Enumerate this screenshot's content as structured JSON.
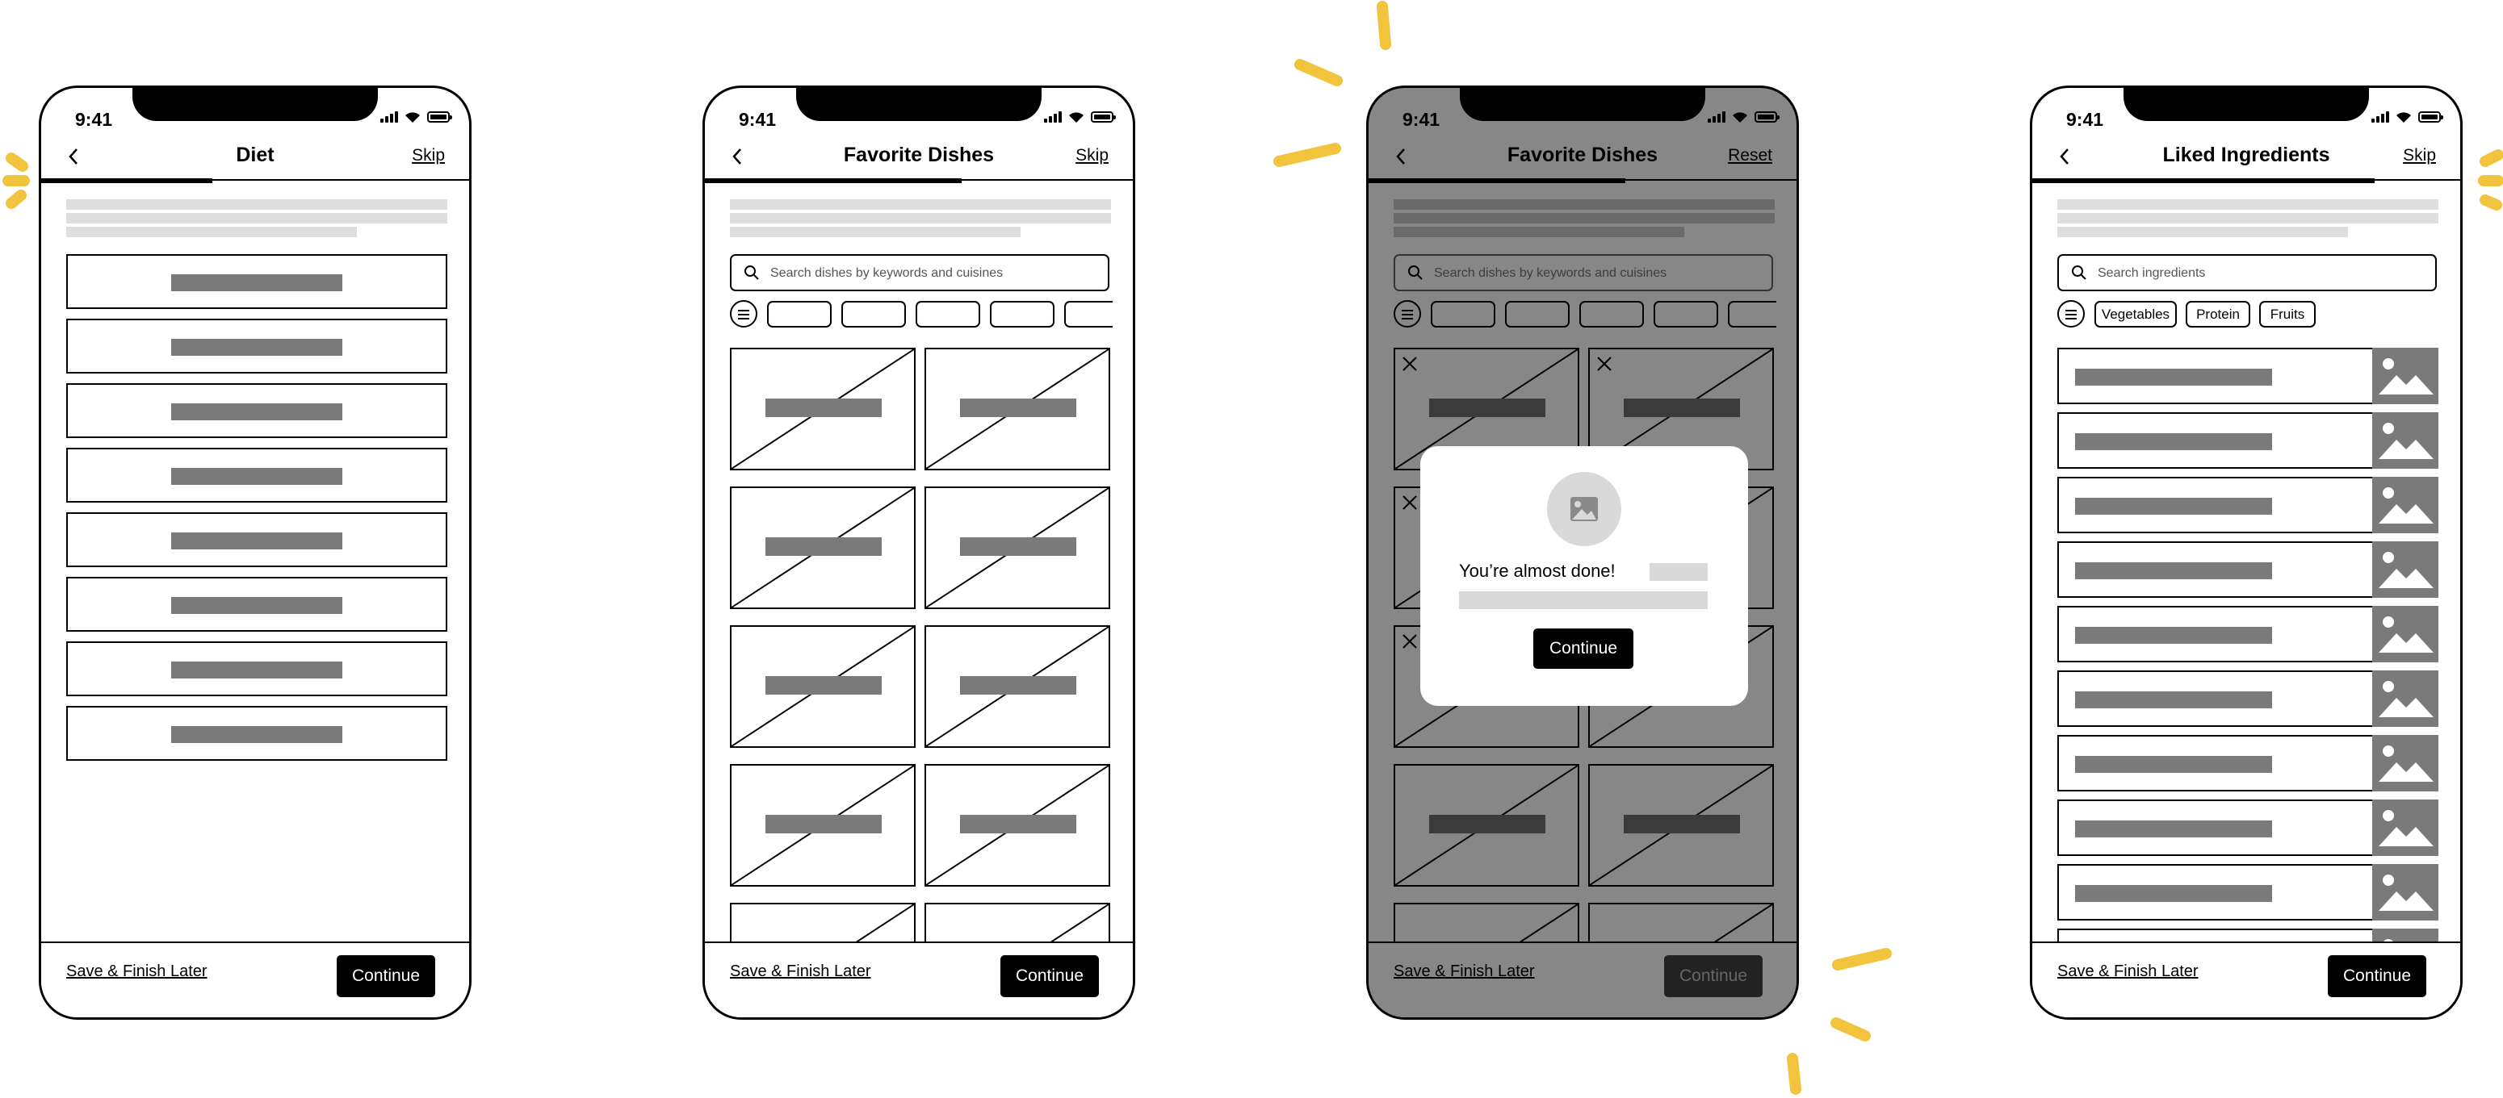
{
  "colors": {
    "accent_yellow": "#f2c43d",
    "overlay_gray": "#878787",
    "placeholder_gray": "#7a7a7a",
    "light_gray": "#dedede"
  },
  "screens": [
    {
      "status_time": "9:41",
      "title": "Diet",
      "top_action": "Skip",
      "progress": 0.4,
      "bottom": {
        "save_label": "Save & Finish Later",
        "continue_label": "Continue"
      }
    },
    {
      "status_time": "9:41",
      "title": "Favorite Dishes",
      "top_action": "Skip",
      "progress": 0.6,
      "search_placeholder": "Search dishes by keywords and cuisines",
      "bottom": {
        "save_label": "Save & Finish Later",
        "continue_label": "Continue"
      }
    },
    {
      "status_time": "9:41",
      "title": "Favorite Dishes",
      "top_action": "Reset",
      "progress": 0.6,
      "search_placeholder": "Search dishes by keywords and cuisines",
      "modal": {
        "message": "You’re almost done!",
        "button_label": "Continue"
      },
      "bottom": {
        "save_label": "Save & Finish Later",
        "continue_label": "Continue"
      }
    },
    {
      "status_time": "9:41",
      "title": "Liked Ingredients",
      "top_action": "Skip",
      "progress": 0.8,
      "search_placeholder": "Search ingredients",
      "filters": [
        "Vegetables",
        "Protein",
        "Fruits"
      ],
      "bottom": {
        "save_label": "Save & Finish Later",
        "continue_label": "Continue"
      }
    }
  ]
}
